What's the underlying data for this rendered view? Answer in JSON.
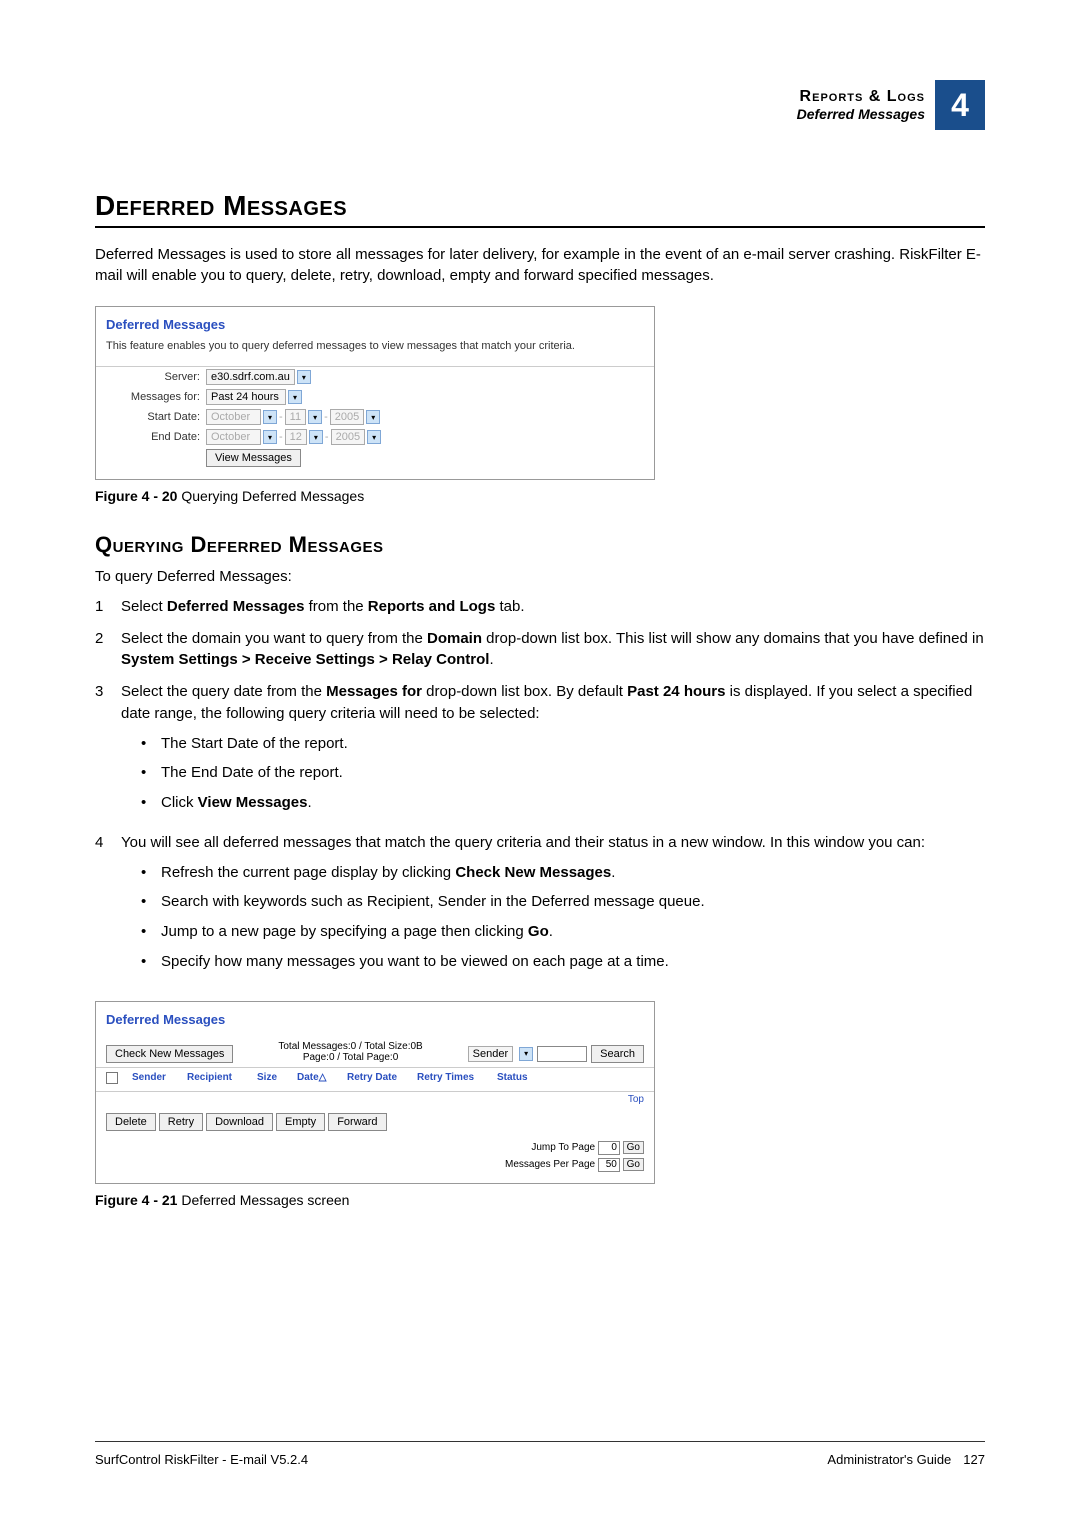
{
  "header": {
    "title": "Reports & Logs",
    "subtitle": "Deferred Messages",
    "chapter_number": "4"
  },
  "h1": "Deferred Messages",
  "intro": "Deferred Messages is used to store all messages for later delivery, for example in the event of an e-mail server crashing. RiskFilter E-mail will enable you to query, delete, retry, download, empty and forward specified messages.",
  "screenshot1": {
    "title": "Deferred Messages",
    "desc": "This feature enables you to query deferred messages to view messages that match your criteria.",
    "labels": {
      "server": "Server:",
      "messages_for": "Messages for:",
      "start_date": "Start Date:",
      "end_date": "End Date:"
    },
    "values": {
      "server": "e30.sdrf.com.au",
      "messages_for": "Past 24 hours",
      "start_month": "October",
      "start_day": "11",
      "start_year": "2005",
      "end_month": "October",
      "end_day": "12",
      "end_year": "2005"
    },
    "button": "View Messages"
  },
  "fig1": {
    "num": "Figure 4 - 20",
    "caption": " Querying Deferred Messages"
  },
  "h2": "Querying Deferred Messages",
  "lead": "To query Deferred Messages:",
  "steps": {
    "s1": {
      "num": "1",
      "pre": "Select ",
      "b1": "Deferred Messages",
      "mid": " from the ",
      "b2": "Reports and Logs",
      "post": " tab."
    },
    "s2": {
      "num": "2",
      "pre": "Select the domain you want to query from the ",
      "b1": "Domain",
      "mid": " drop-down list box. This list will show any domains that you have defined in ",
      "b2": "System Settings > Receive Settings > Relay Control",
      "post": "."
    },
    "s3": {
      "num": "3",
      "pre": "Select the query date from the ",
      "b1": "Messages for",
      "mid": " drop-down list box. By default ",
      "b2": "Past 24 hours",
      "post": " is displayed. If you select a specified date range, the following query criteria will need to be selected:",
      "bullets": {
        "b1": "The Start Date of the report.",
        "b2": "The End Date of the report.",
        "b3pre": "Click ",
        "b3b": "View Messages",
        "b3post": "."
      }
    },
    "s4": {
      "num": "4",
      "text": "You will see all deferred messages that match the query criteria and their status in a new window. In this window you can:",
      "bullets": {
        "b1pre": "Refresh the current page display by clicking ",
        "b1b": "Check New Messages",
        "b1post": ".",
        "b2": "Search with keywords such as Recipient, Sender in the Deferred message queue.",
        "b3pre": "Jump to a new page by specifying a page then clicking ",
        "b3b": "Go",
        "b3post": ".",
        "b4": "Specify how many messages you want to be viewed on each page at a time."
      }
    }
  },
  "screenshot2": {
    "title": "Deferred Messages",
    "check_new": "Check New Messages",
    "totals_line1": "Total Messages:0 / Total Size:0B",
    "totals_line2": "Page:0 / Total Page:0",
    "search_field": "Sender",
    "search_btn": "Search",
    "cols": {
      "sender": "Sender",
      "recipient": "Recipient",
      "size": "Size",
      "date": "Date",
      "retry_date": "Retry Date",
      "retry_times": "Retry Times",
      "status": "Status"
    },
    "actions": {
      "delete": "Delete",
      "retry": "Retry",
      "download": "Download",
      "empty": "Empty",
      "forward": "Forward"
    },
    "top_link": "Top",
    "jump_label": "Jump To Page",
    "jump_value": "0",
    "per_page_label": "Messages Per Page",
    "per_page_value": "50",
    "go": "Go"
  },
  "fig2": {
    "num": "Figure 4 - 21",
    "caption": " Deferred Messages screen"
  },
  "footer": {
    "left": "SurfControl RiskFilter - E-mail V5.2.4",
    "right_label": "Administrator's Guide",
    "page": "127"
  }
}
